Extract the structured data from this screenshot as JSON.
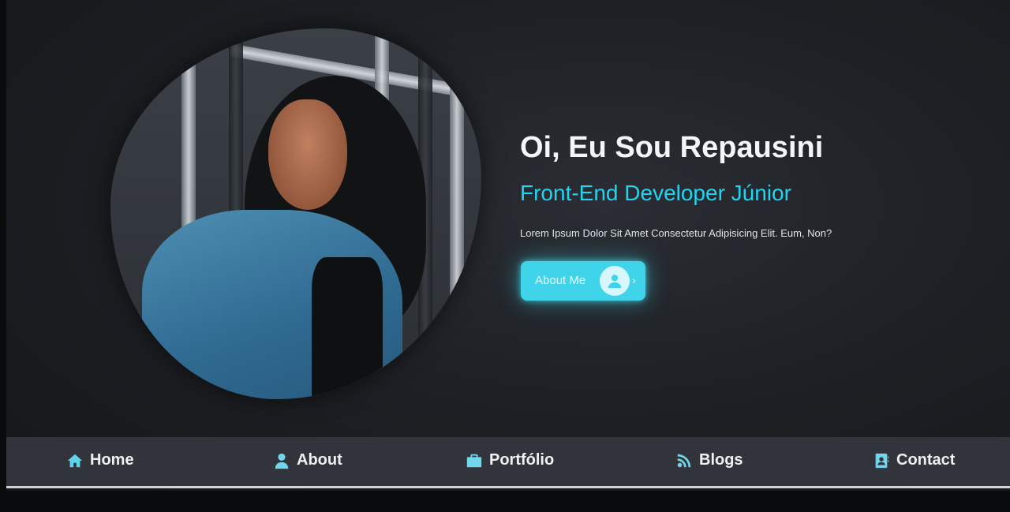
{
  "hero": {
    "title": "Oi, Eu Sou Repausini",
    "subtitle": "Front-End Developer Júnior",
    "description": "Lorem Ipsum Dolor Sit Amet Consectetur Adipisicing Elit. Eum, Non?",
    "cta_label": "About Me",
    "cta_arrow": "›",
    "cta_icon": "user-icon",
    "photo_icon": "profile-photo"
  },
  "nav": {
    "items": [
      {
        "label": "Home",
        "icon": "home-icon",
        "active": true
      },
      {
        "label": "About",
        "icon": "user-icon"
      },
      {
        "label": "Portfólio",
        "icon": "briefcase-icon"
      },
      {
        "label": "Blogs",
        "icon": "blog-icon"
      },
      {
        "label": "Contact",
        "icon": "contact-icon"
      }
    ]
  },
  "colors": {
    "accent": "#3fd4ea",
    "subtitle": "#22d4f0",
    "background": "#1d2024",
    "navbar": "#31353b"
  }
}
